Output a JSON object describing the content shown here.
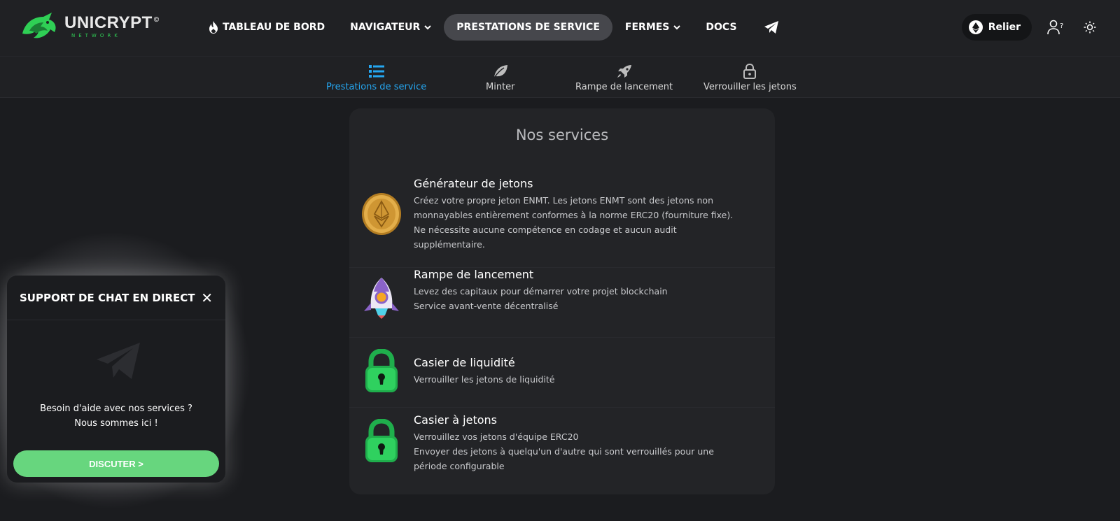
{
  "brand": {
    "name": "UNICRYPT",
    "mark": "©",
    "sub": "NETWORK"
  },
  "nav": {
    "items": [
      {
        "label": "TABLEAU DE BORD",
        "icon": "flame-icon"
      },
      {
        "label": "NAVIGATEUR",
        "icon": "chevron-down-icon"
      },
      {
        "label": "PRESTATIONS DE SERVICE",
        "active": true
      },
      {
        "label": "FERMES",
        "icon": "chevron-down-icon"
      },
      {
        "label": "DOCS"
      },
      {
        "label": "",
        "icon": "telegram-icon"
      }
    ]
  },
  "header": {
    "connect_label": "Relier"
  },
  "subnav": {
    "tabs": [
      {
        "label": "Prestations de service",
        "icon": "list-icon",
        "active": true
      },
      {
        "label": "Minter",
        "icon": "leaf-icon"
      },
      {
        "label": "Rampe de lancement",
        "icon": "rocket-icon"
      },
      {
        "label": "Verrouiller les jetons",
        "icon": "lock-icon"
      }
    ]
  },
  "services": {
    "title": "Nos services",
    "items": [
      {
        "title": "Générateur de jetons",
        "lines": [
          "Créez votre propre jeton ENMT. Les jetons ENMT sont des jetons non",
          "monnayables entièrement conformes à la norme ERC20 (fourniture fixe).",
          "Ne nécessite aucune compétence en codage et aucun audit",
          "supplémentaire."
        ],
        "icon": "gold-coin-icon"
      },
      {
        "title": "Rampe de lancement",
        "lines": [
          "Levez des capitaux pour démarrer votre projet blockchain",
          "Service avant-vente décentralisé"
        ],
        "icon": "rocket-icon"
      },
      {
        "title": "Casier de liquidité",
        "lines": [
          "Verrouiller les jetons de liquidité"
        ],
        "icon": "green-lock-icon"
      },
      {
        "title": "Casier à jetons",
        "lines": [
          "Verrouillez vos jetons d'équipe ERC20",
          "Envoyer des jetons à quelqu'un d'autre qui sont verrouillés pour une",
          "période configurable"
        ],
        "icon": "green-lock-icon"
      }
    ]
  },
  "chat": {
    "title": "SUPPORT DE CHAT EN DIRECT",
    "close": "✕",
    "message_1": "Besoin d'aide avec nos services ?",
    "message_2": "Nous sommes ici !",
    "button": "DISCUTER >"
  },
  "colors": {
    "accent": "#25a6f0",
    "brand_green": "#2fcf55",
    "chat_button": "#67d67e"
  }
}
